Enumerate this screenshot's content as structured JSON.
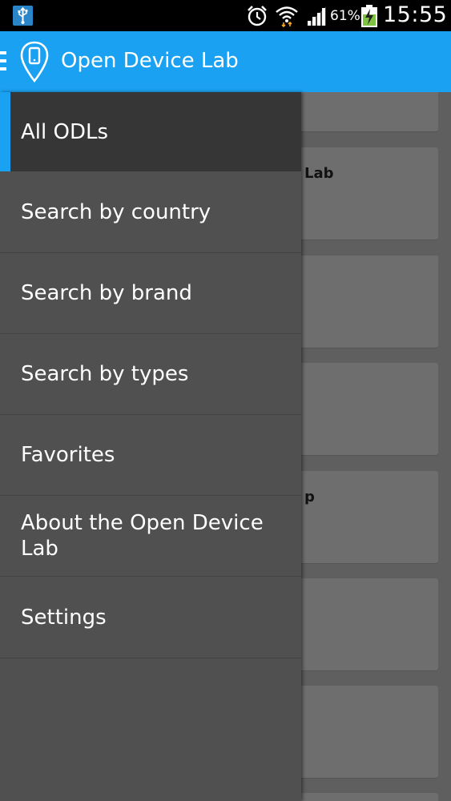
{
  "status_bar": {
    "battery_percent": "61%",
    "time": "15:55",
    "icons": [
      "usb-debugging-icon",
      "alarm-icon",
      "wifi-icon",
      "signal-icon",
      "battery-charging-icon"
    ]
  },
  "action_bar": {
    "title": "Open Device Lab",
    "color": "#1ba1f1"
  },
  "drawer": {
    "items": [
      {
        "label": "All ODLs",
        "selected": true
      },
      {
        "label": "Search by country"
      },
      {
        "label": "Search by brand"
      },
      {
        "label": "Search by types"
      },
      {
        "label": "Favorites"
      },
      {
        "label": "About the Open Device Lab"
      },
      {
        "label": "Settings"
      }
    ]
  },
  "background_list": {
    "visible_fragments": [
      "Lab",
      "p"
    ]
  }
}
